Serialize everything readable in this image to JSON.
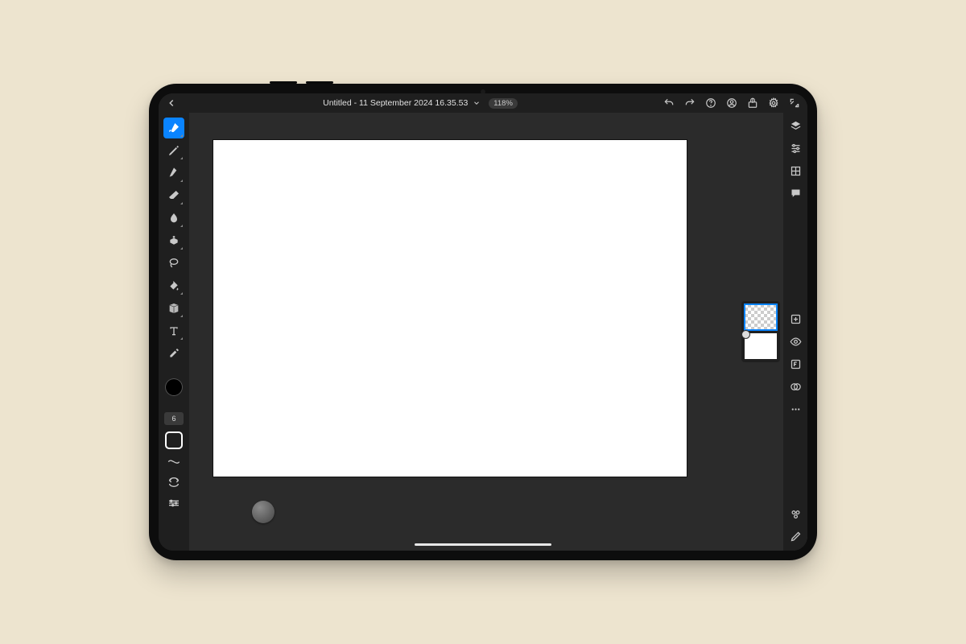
{
  "header": {
    "title": "Untitled - 11 September 2024 16.35.53",
    "zoom": "118%"
  },
  "brush": {
    "size": "6"
  },
  "tools": [
    {
      "name": "brush",
      "selected": true,
      "hasMore": true
    },
    {
      "name": "pencil",
      "selected": false,
      "hasMore": true
    },
    {
      "name": "pen",
      "selected": false,
      "hasMore": true
    },
    {
      "name": "eraser",
      "selected": false,
      "hasMore": true
    },
    {
      "name": "smudge",
      "selected": false,
      "hasMore": true
    },
    {
      "name": "clone",
      "selected": false,
      "hasMore": true
    },
    {
      "name": "lasso",
      "selected": false,
      "hasMore": false
    },
    {
      "name": "fill",
      "selected": false,
      "hasMore": true
    },
    {
      "name": "gradient",
      "selected": false,
      "hasMore": true
    },
    {
      "name": "text",
      "selected": false,
      "hasMore": true
    },
    {
      "name": "eyedropper",
      "selected": false,
      "hasMore": false
    }
  ],
  "layers": [
    {
      "id": "layer-1",
      "selected": true,
      "transparent": true,
      "badge": false
    },
    {
      "id": "layer-bg",
      "selected": false,
      "transparent": false,
      "badge": true
    }
  ],
  "colors": {
    "foreground": "#000000",
    "accent": "#0a84ff"
  }
}
